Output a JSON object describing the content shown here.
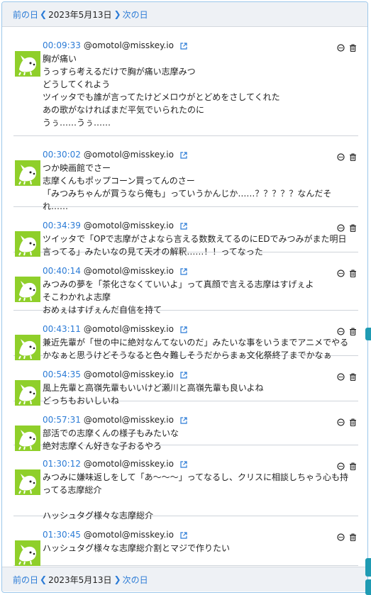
{
  "nav": {
    "prev_label": "前の日",
    "date": "2023年5月13日",
    "next_label": "次の日"
  },
  "posts": [
    {
      "time": "00:09:33",
      "user": "@omotol@misskey.io",
      "lines": [
        "胸が痛い",
        "うっすら考えるだけで胸が痛い志摩みつ",
        "どうしてくれよう",
        "ツイッタでも誰が言ってたけどメロウがとどめをさしてくれた",
        "あの歌がなければまだ平気でいられたのに",
        "うぅ……うぅ……"
      ]
    },
    {
      "time": "00:30:02",
      "user": "@omotol@misskey.io",
      "lines": [
        "つか映画館でさー",
        "志摩くんもポップコーン買ってんのさー",
        "「みつみちゃんが買うなら俺も」っていうかんじか……？？？？？なんだそ",
        "れ……"
      ]
    },
    {
      "time": "00:34:39",
      "user": "@omotol@misskey.io",
      "lines": [
        "ツイッタで「OPで志摩がさよなら言える数数えてるのにEDでみつみがまた明日",
        "言ってる」みたいなの見て天才の解釈……！！ってなった"
      ]
    },
    {
      "time": "00:40:14",
      "user": "@omotol@misskey.io",
      "lines": [
        "みつみの夢を「茶化さなくていいよ」って真顔で言える志摩はすげぇよ",
        "そこわかれよ志摩",
        "おめぇはすげぇんだ自信を持て"
      ]
    },
    {
      "time": "00:43:11",
      "user": "@omotol@misskey.io",
      "lines": [
        "兼近先輩が「世の中に絶対なんてないのだ」みたいな事をいうまでアニメでやる",
        "かなぁと思うけどそうなると色々難しそうだからまぁ文化祭終了までかなぁ"
      ]
    },
    {
      "time": "00:54:35",
      "user": "@omotol@misskey.io",
      "lines": [
        "風上先輩と高嶺先輩もいいけど瀬川と高嶺先輩も良いよね",
        "どっちもおいしいね"
      ]
    },
    {
      "time": "00:57:31",
      "user": "@omotol@misskey.io",
      "lines": [
        "部活での志摩くんの様子もみたいな",
        "絶対志摩くん好きな子おるやろ"
      ]
    },
    {
      "time": "01:30:12",
      "user": "@omotol@misskey.io",
      "lines": [
        "みつみに嫌味返しをして「あ～～～」ってなるし、クリスに相談しちゃう心も持",
        "ってる志摩総介",
        "",
        "ハッシュタグ様々な志摩総介"
      ]
    },
    {
      "time": "01:30:45",
      "user": "@omotol@misskey.io",
      "lines": [
        "ハッシュタグ様々な志摩総介割とマジで作りたい"
      ]
    }
  ],
  "icons": {
    "avatar": "dog-avatar",
    "external": "external-link-icon",
    "quote": "quote-icon",
    "delete": "trash-icon",
    "prev": "chevron-left-icon",
    "next": "chevron-right-icon"
  },
  "colors": {
    "link": "#2b7bd6",
    "accent": "#1f9bb3",
    "avatar_bg": "#8fcf2a"
  }
}
